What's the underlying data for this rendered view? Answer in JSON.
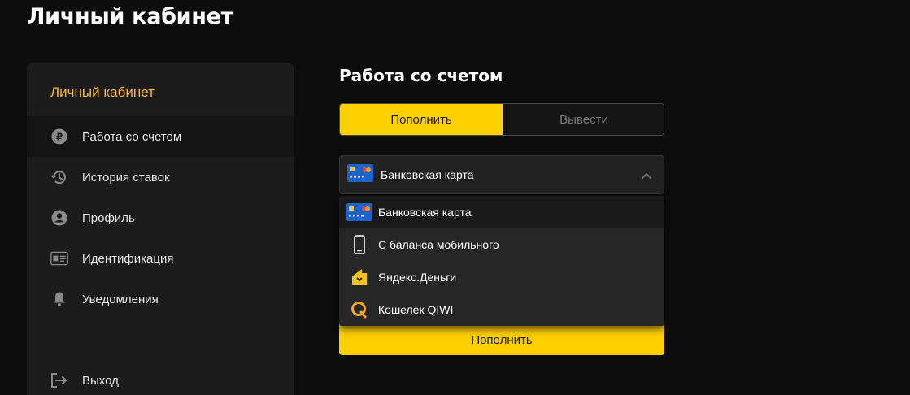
{
  "page": {
    "title": "Личный кабинет"
  },
  "sidebar": {
    "header": "Личный кабинет",
    "items": [
      {
        "label": "Работа со счетом",
        "icon": "ruble-coin-icon",
        "active": true
      },
      {
        "label": "История ставок",
        "icon": "history-clock-icon",
        "active": false
      },
      {
        "label": "Профиль",
        "icon": "user-circle-icon",
        "active": false
      },
      {
        "label": "Идентификация",
        "icon": "id-card-icon",
        "active": false
      },
      {
        "label": "Уведомления",
        "icon": "bell-icon",
        "active": false
      },
      {
        "label": "Выход",
        "icon": "logout-icon",
        "active": false
      }
    ]
  },
  "main": {
    "section_title": "Работа со счетом",
    "tabs": [
      {
        "label": "Пополнить",
        "active": true
      },
      {
        "label": "Вывести",
        "active": false
      }
    ],
    "method_select": {
      "value": "Банковская карта",
      "icon": "bank-card-icon",
      "expanded": true
    },
    "method_options": [
      {
        "label": "Банковская карта",
        "icon": "bank-card-icon",
        "selected": true
      },
      {
        "label": "С баланса мобильного",
        "icon": "mobile-phone-icon",
        "selected": false
      },
      {
        "label": "Яндекс.Деньги",
        "icon": "yandex-money-icon",
        "selected": false
      },
      {
        "label": "Кошелек QIWI",
        "icon": "qiwi-icon",
        "selected": false
      }
    ],
    "submit_label": "Пополнить"
  },
  "colors": {
    "accent": "#ffd000",
    "sidebar_header": "#f5b731",
    "background": "#0d0d0d",
    "panel": "#1c1c1c"
  }
}
